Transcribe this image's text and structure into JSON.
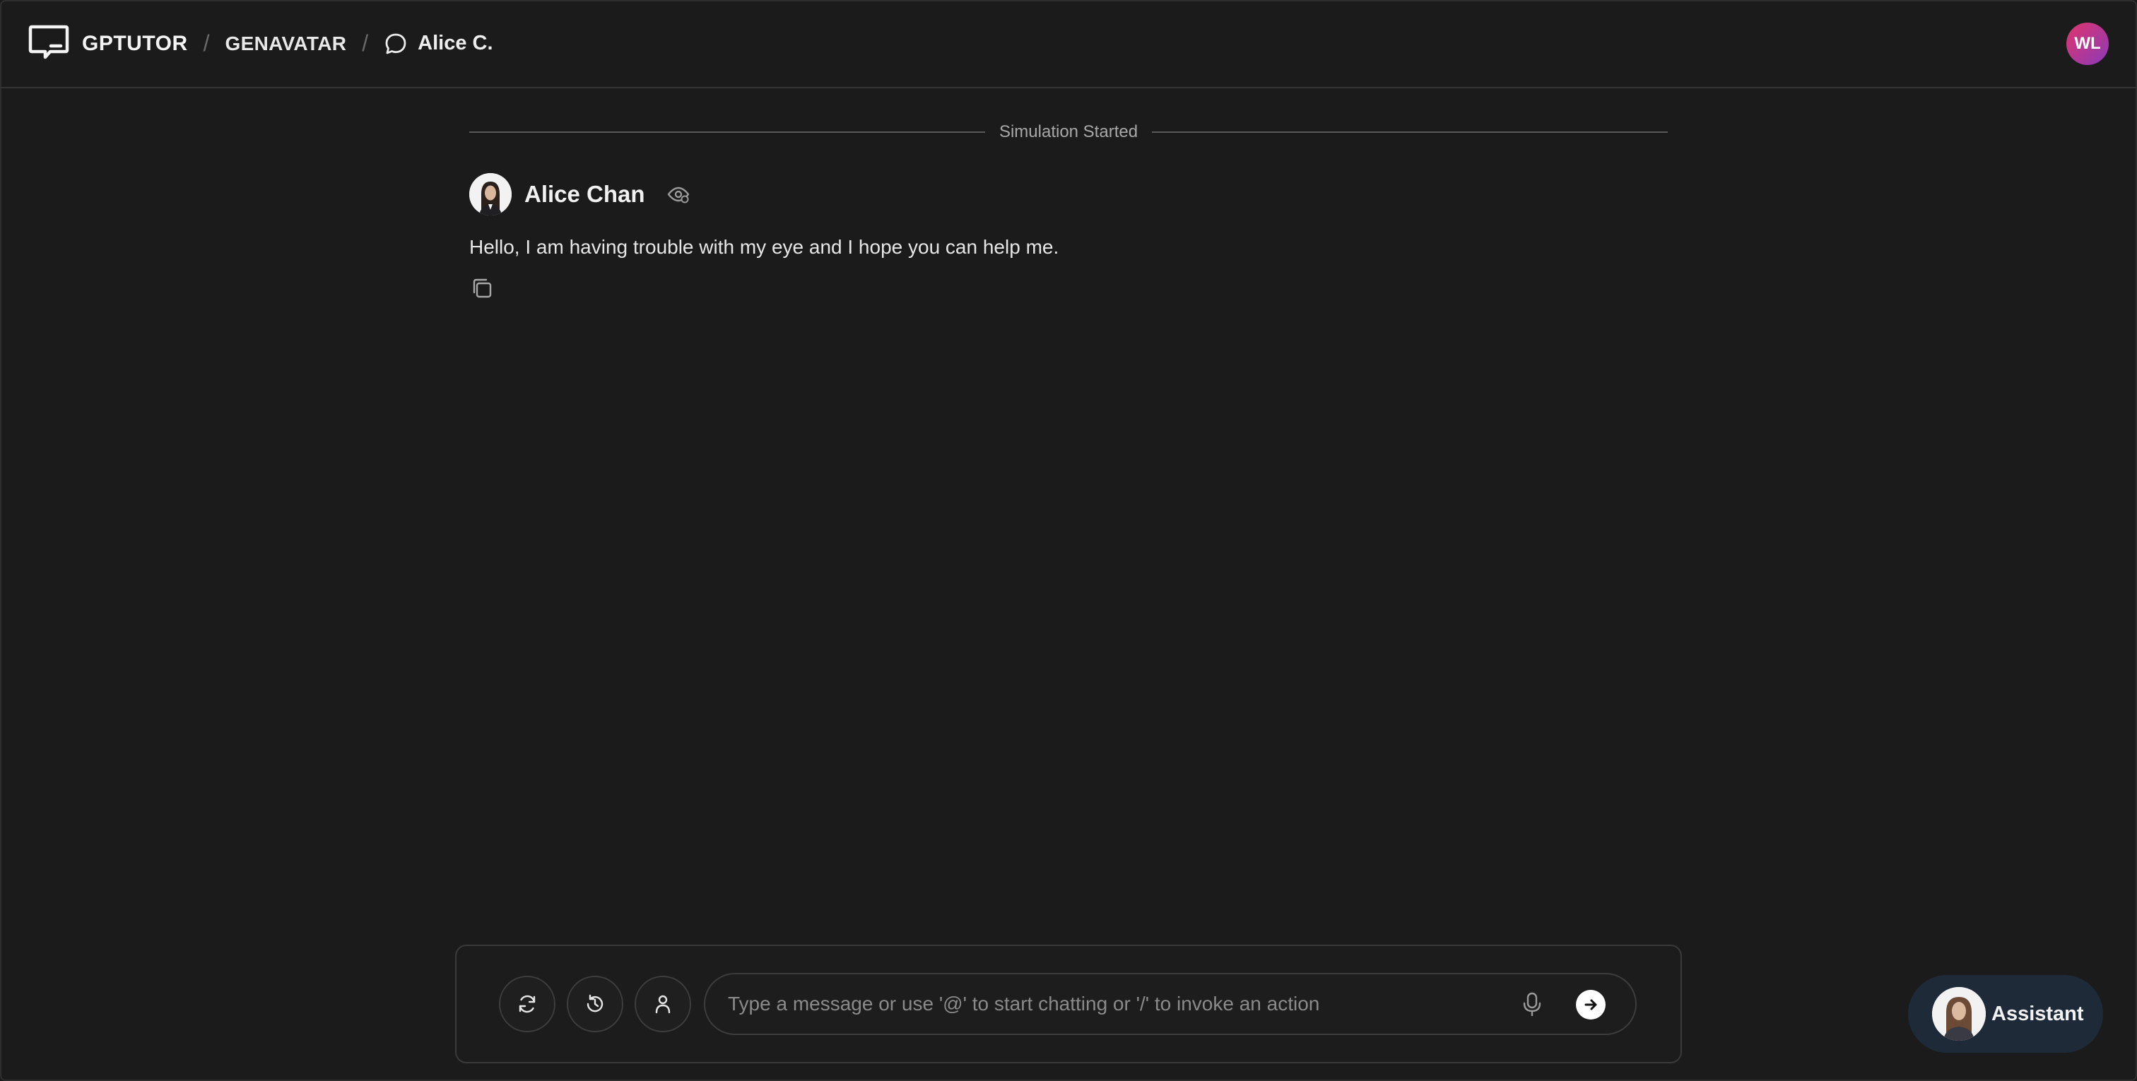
{
  "header": {
    "brand": "GPTUTOR",
    "crumb_1": "GENAVATAR",
    "crumb_2": "Alice C.",
    "user_initials": "WL"
  },
  "colors": {
    "background": "#1b1b1b",
    "user_avatar_gradient_start": "#e0356b",
    "user_avatar_gradient_end": "#8a3ab9",
    "assistant_pill": "#1f2a38"
  },
  "chat": {
    "divider_label": "Simulation Started",
    "messages": [
      {
        "sender": "Alice Chan",
        "text": "Hello, I am having trouble with my eye and I hope you can help me."
      }
    ]
  },
  "composer": {
    "placeholder": "Type a message or use '@' to start chatting or '/' to invoke an action",
    "value": "",
    "icons": [
      "refresh-icon",
      "history-icon",
      "person-icon",
      "microphone-icon",
      "send-arrow-icon"
    ]
  },
  "assistant": {
    "label": "Assistant"
  }
}
